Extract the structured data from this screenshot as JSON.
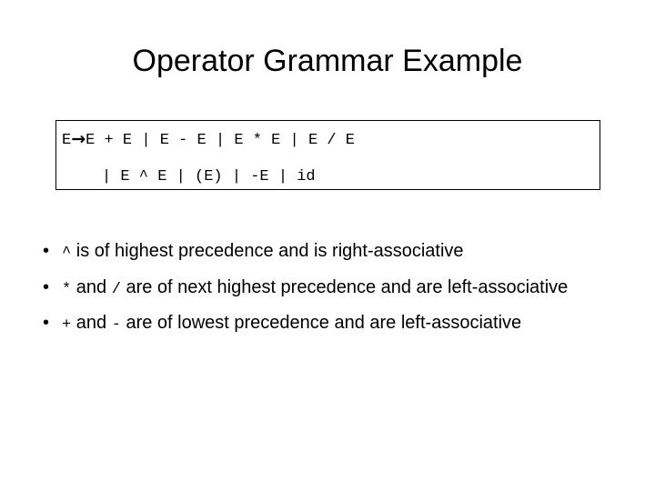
{
  "slide": {
    "title": "Operator Grammar Example",
    "background_color": "#ffffff",
    "text_color": "#000000"
  },
  "grammar_box": {
    "border_color": "#000000",
    "nonterminal": "E",
    "arrow_symbol": "→",
    "line1_prefix": "E",
    "line1_productions": "E + E | E - E | E * E | E / E",
    "line2": "| E ^ E | (E) | -E | id",
    "full_rule": "E → E + E | E - E | E * E | E / E | E ^ E | (E) | -E | id"
  },
  "bullets": {
    "marker": "•",
    "items": [
      {
        "operators": "^",
        "text": " is of highest precedence and is right-associative",
        "full": "^ is of highest precedence and is right-associative"
      },
      {
        "op_first": "*",
        "mid_text": " and ",
        "op_second": "/",
        "text": "  are of next highest precedence and are left-associative",
        "full": "* and /  are of next highest precedence and are left-associative"
      },
      {
        "op_first": "+",
        "mid_text": " and ",
        "op_second": "-",
        "text": "  are of lowest precedence and are left-associative",
        "full": "+ and -  are of lowest precedence and are left-associative"
      }
    ]
  }
}
